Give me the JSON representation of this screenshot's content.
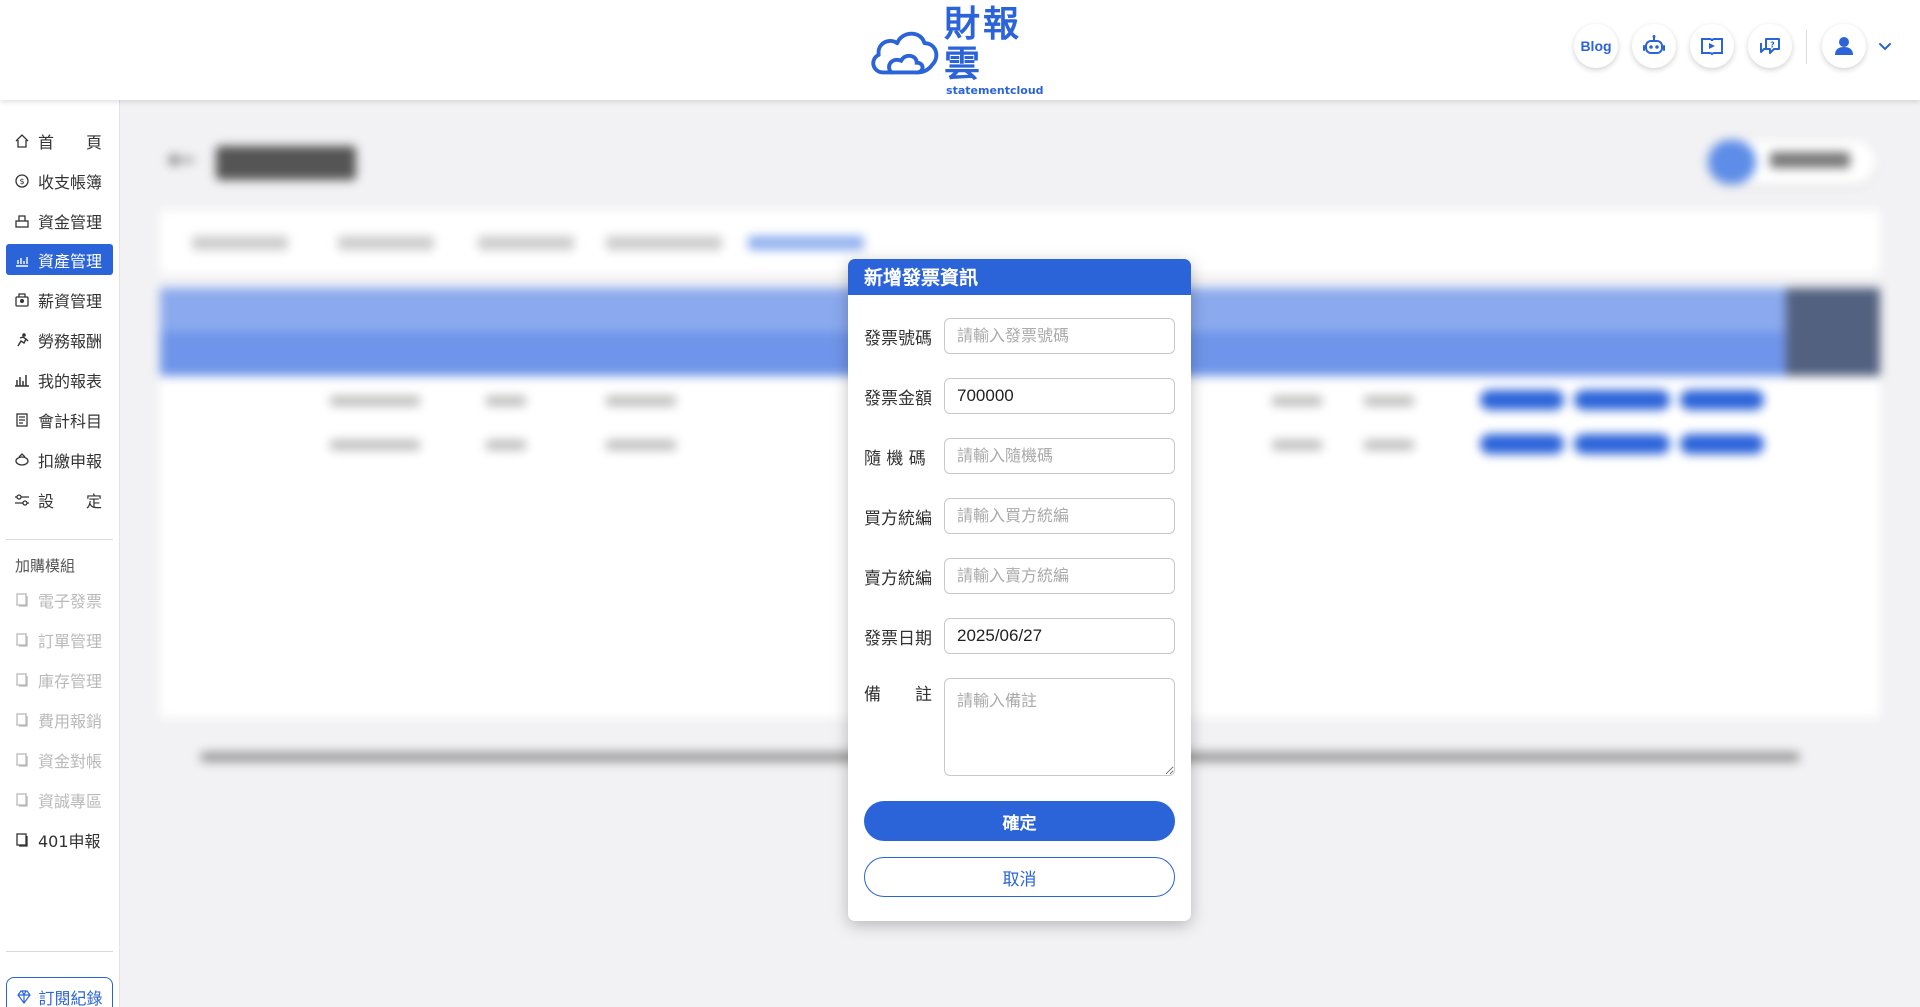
{
  "header": {
    "brand_cn": "財報雲",
    "brand_en": "statementcloud",
    "blog_label": "Blog",
    "icons": [
      "robot-icon",
      "video-book-icon",
      "help-chat-icon",
      "user-avatar-icon",
      "chevron-down-icon"
    ],
    "accent_color": "#2b63d9"
  },
  "sidebar": {
    "items": [
      {
        "label": "首　　頁",
        "icon": "home-icon"
      },
      {
        "label": "收支帳簿",
        "icon": "coin-icon"
      },
      {
        "label": "資金管理",
        "icon": "fund-icon"
      },
      {
        "label": "資產管理",
        "icon": "asset-icon",
        "active": true
      },
      {
        "label": "薪資管理",
        "icon": "salary-icon"
      },
      {
        "label": "勞務報酬",
        "icon": "labor-icon"
      },
      {
        "label": "我的報表",
        "icon": "report-icon"
      },
      {
        "label": "會計科目",
        "icon": "ledger-icon"
      },
      {
        "label": "扣繳申報",
        "icon": "withholding-icon"
      },
      {
        "label": "設　　定",
        "icon": "settings-icon"
      }
    ],
    "addon_caption": "加購模組",
    "addon_items": [
      {
        "label": "電子發票",
        "icon": "module-icon",
        "disabled": true
      },
      {
        "label": "訂單管理",
        "icon": "module-icon",
        "disabled": true
      },
      {
        "label": "庫存管理",
        "icon": "module-icon",
        "disabled": true
      },
      {
        "label": "費用報銷",
        "icon": "module-icon",
        "disabled": true
      },
      {
        "label": "資金對帳",
        "icon": "module-icon",
        "disabled": true
      },
      {
        "label": "資誠專區",
        "icon": "module-icon",
        "disabled": true
      },
      {
        "label": "401申報",
        "icon": "module-icon",
        "disabled": false
      }
    ],
    "subscription_label": "訂閱紀錄"
  },
  "modal": {
    "title": "新增發票資訊",
    "fields": {
      "invoice_no": {
        "label": "發票號碼",
        "value": "",
        "placeholder": "請輸入發票號碼"
      },
      "amount": {
        "label": "發票金額",
        "value": "700000",
        "placeholder": ""
      },
      "random_code": {
        "label": "隨 機 碼",
        "value": "",
        "placeholder": "請輸入隨機碼"
      },
      "buyer_tax_id": {
        "label": "買方統編",
        "value": "",
        "placeholder": "請輸入買方統編"
      },
      "seller_tax_id": {
        "label": "賣方統編",
        "value": "",
        "placeholder": "請輸入賣方統編"
      },
      "invoice_date": {
        "label": "發票日期",
        "value": "2025/06/27",
        "placeholder": ""
      },
      "note": {
        "label": "備　　註",
        "value": "",
        "placeholder": "請輸入備註"
      }
    },
    "confirm_label": "確定",
    "cancel_label": "取消"
  }
}
